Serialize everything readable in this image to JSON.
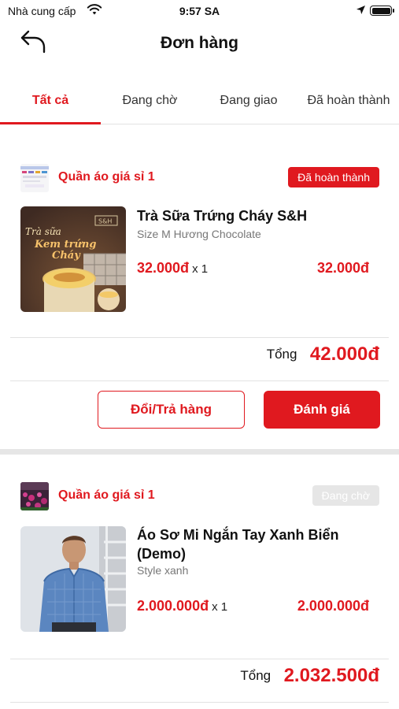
{
  "status_bar": {
    "carrier": "Nhà cung cấp",
    "time": "9:57 SA"
  },
  "header": {
    "title": "Đơn hàng"
  },
  "tabs": [
    {
      "label": "Tất cả",
      "active": true
    },
    {
      "label": "Đang chờ",
      "active": false
    },
    {
      "label": "Đang giao",
      "active": false
    },
    {
      "label": "Đã hoàn thành",
      "active": false
    }
  ],
  "orders": [
    {
      "shop_name": "Quần áo giá sỉ 1",
      "status": "Đã hoàn thành",
      "product": {
        "name": "Trà Sữa Trứng Cháy S&H",
        "variant": "Size M  Hương  Chocolate",
        "price": "32.000đ",
        "qty": "x 1",
        "line_total": "32.000đ",
        "image_text": [
          "Trà sữa",
          "Kem trứng",
          "Cháy",
          "S&H"
        ]
      },
      "total_label": "Tổng",
      "total_value": "42.000đ",
      "buttons": {
        "return": "Đổi/Trả hàng",
        "review": "Đánh giá"
      }
    },
    {
      "shop_name": "Quần áo giá sỉ 1",
      "status": "Đang chờ",
      "product": {
        "name": "Áo Sơ Mi Ngắn Tay Xanh Biển (Demo)",
        "variant": "Style xanh",
        "price": "2.000.000đ",
        "qty": "x 1",
        "line_total": "2.000.000đ"
      },
      "total_label": "Tổng",
      "total_value": "2.032.500đ"
    }
  ],
  "colors": {
    "accent": "#e0191f",
    "muted_badge": "#e6e6e6",
    "separator": "#e2e2e2"
  },
  "icons": {
    "back": "back-arrow-icon",
    "wifi": "wifi-icon",
    "location": "location-arrow-icon",
    "battery": "battery-icon"
  }
}
